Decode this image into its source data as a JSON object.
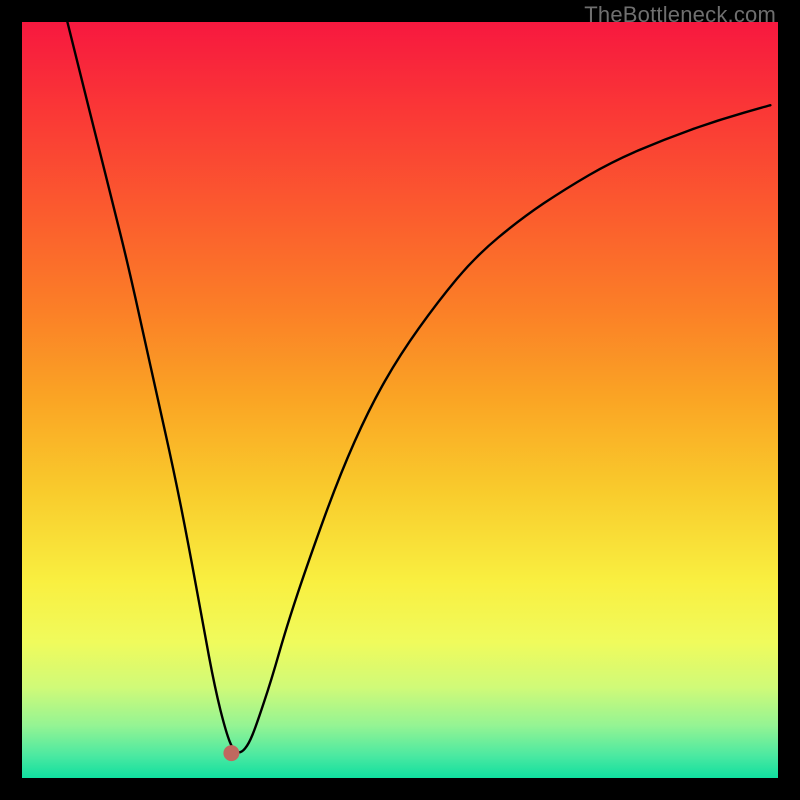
{
  "watermark": "TheBottleneck.com",
  "gradient": {
    "stops": [
      {
        "offset": 0.0,
        "color": "#f7183f"
      },
      {
        "offset": 0.12,
        "color": "#fa3836"
      },
      {
        "offset": 0.25,
        "color": "#fb5b2e"
      },
      {
        "offset": 0.38,
        "color": "#fb7f27"
      },
      {
        "offset": 0.5,
        "color": "#faa524"
      },
      {
        "offset": 0.62,
        "color": "#f9cb2c"
      },
      {
        "offset": 0.74,
        "color": "#f9ef40"
      },
      {
        "offset": 0.82,
        "color": "#f0fb5c"
      },
      {
        "offset": 0.88,
        "color": "#d0fa78"
      },
      {
        "offset": 0.93,
        "color": "#95f493"
      },
      {
        "offset": 0.97,
        "color": "#4ce9a1"
      },
      {
        "offset": 1.0,
        "color": "#10dfa0"
      }
    ]
  },
  "marker": {
    "x_frac": 0.277,
    "y_frac": 0.967,
    "r": 8,
    "fill": "#c0685f"
  },
  "chart_data": {
    "type": "line",
    "title": "",
    "xlabel": "",
    "ylabel": "",
    "xlim": [
      0,
      100
    ],
    "ylim": [
      0,
      100
    ],
    "note": "No axes, ticks, or numeric labels are rendered in the image; values below are estimated positions (percent of plot width on x, percent of plot height from bottom on y) of the drawn black curve. Higher y means higher on screen.",
    "series": [
      {
        "name": "curve",
        "x": [
          6,
          8,
          10,
          12,
          14,
          16,
          18,
          20,
          22,
          24,
          25.5,
          27,
          28,
          29,
          30,
          31,
          33,
          35,
          38,
          42,
          46,
          50,
          55,
          60,
          66,
          72,
          78,
          85,
          92,
          99
        ],
        "y": [
          100,
          92,
          84,
          76,
          68,
          59,
          50,
          41,
          31,
          20,
          12,
          6,
          3.5,
          3.3,
          4.5,
          7,
          13,
          20,
          29,
          40,
          49,
          56,
          63,
          69,
          74,
          78,
          81.5,
          84.5,
          87,
          89
        ]
      }
    ],
    "marker_point": {
      "x": 27.7,
      "y": 3.3
    }
  }
}
